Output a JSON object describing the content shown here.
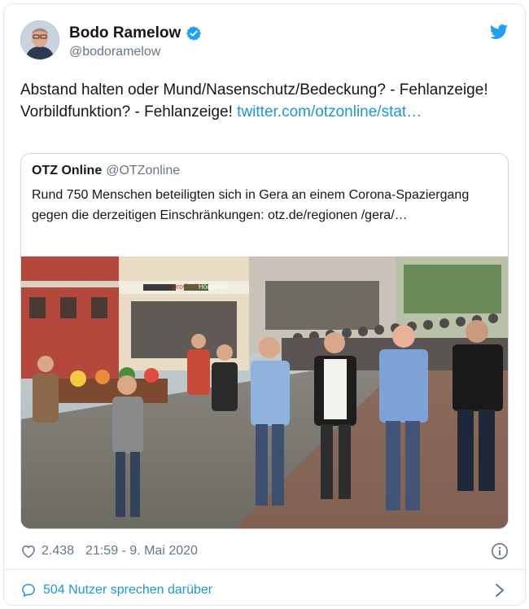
{
  "author": {
    "display_name": "Bodo Ramelow",
    "handle": "@bodoramelow"
  },
  "tweet": {
    "line1": "Abstand halten oder Mund/Nasenschutz/Bedeckung? - Fehlanzeige!",
    "line2": "Vorbildfunktion? - Fehlanzeige!",
    "link": "twitter.com/otzonline/stat…"
  },
  "quoted": {
    "display_name": "OTZ Online",
    "handle": "@OTZonline",
    "text": "Rund 750 Menschen beteiligten sich in Gera an einem Corona-Spaziergang gegen die derzeitigen Einschränkungen: otz.de/regionen /gera/…",
    "photo_signs": [
      "proOptik",
      "Hörgeräte"
    ]
  },
  "meta": {
    "likes": "2.438",
    "timestamp": "21:59 - 9. Mai 2020"
  },
  "footer": {
    "conversation": "504 Nutzer sprechen darüber"
  },
  "colors": {
    "link": "#1b95e0",
    "verified": "#1da1f2",
    "secondary_text": "#657786",
    "border": "#e1e8ed"
  },
  "icons": [
    "verified-badge-icon",
    "twitter-bird-icon",
    "heart-icon",
    "info-icon",
    "speech-bubble-icon",
    "chevron-right-icon"
  ]
}
